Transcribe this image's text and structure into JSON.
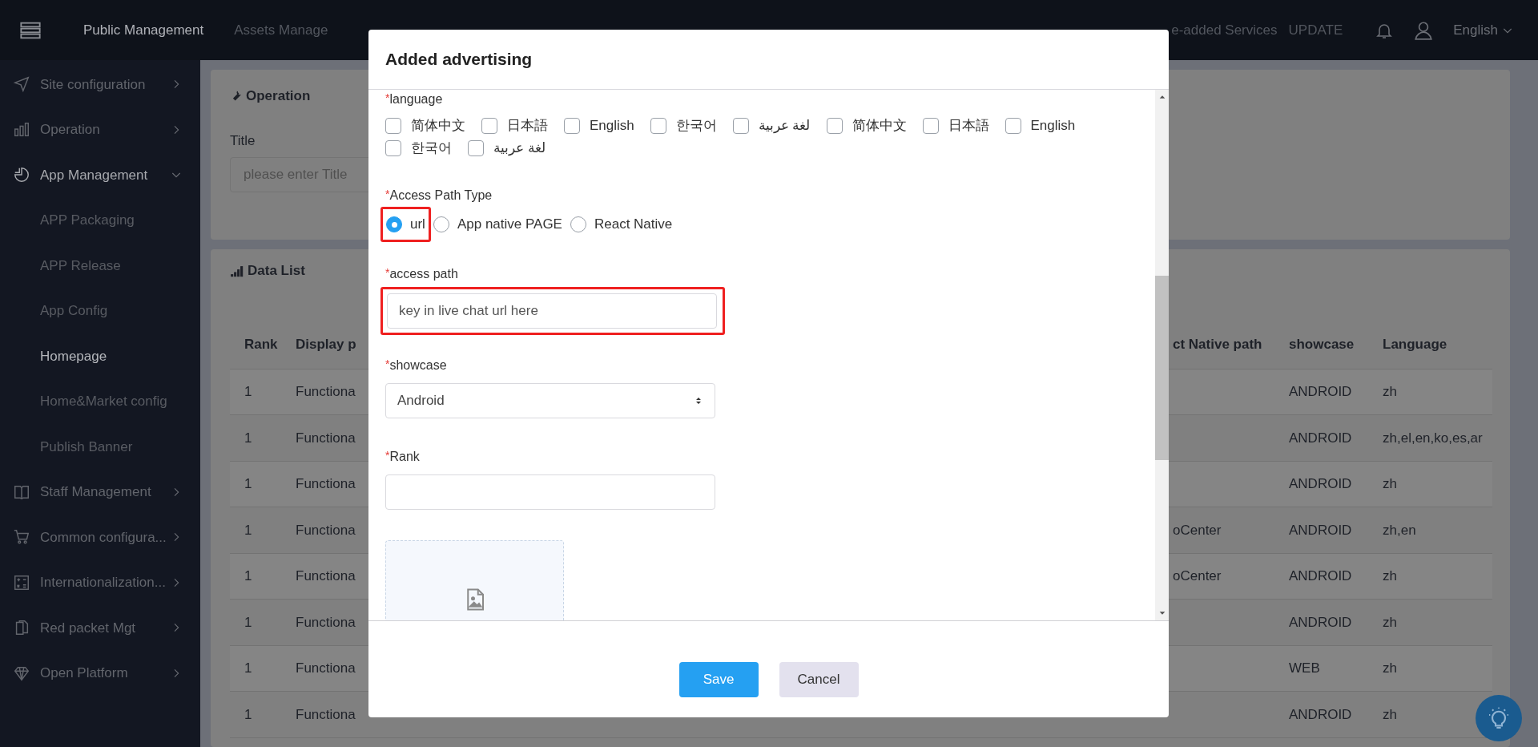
{
  "top_nav": {
    "items": [
      {
        "label": "Public Management",
        "selected": true
      },
      {
        "label": "Assets Manage",
        "selected": false
      }
    ],
    "right_items": [
      {
        "label": "e-added Services"
      },
      {
        "label": "UPDATE"
      }
    ],
    "language": "English"
  },
  "sidebar": {
    "items": [
      {
        "label": "Site configuration",
        "expanded": false
      },
      {
        "label": "Operation",
        "expanded": false
      },
      {
        "label": "App Management",
        "expanded": true,
        "children": [
          {
            "label": "APP Packaging",
            "selected": false
          },
          {
            "label": "APP Release",
            "selected": false
          },
          {
            "label": "App Config",
            "selected": false
          },
          {
            "label": "Homepage",
            "selected": true
          },
          {
            "label": "Home&Market config",
            "selected": false
          },
          {
            "label": "Publish Banner",
            "selected": false
          }
        ]
      },
      {
        "label": "Staff Management",
        "expanded": false
      },
      {
        "label": "Common configura...",
        "expanded": false
      },
      {
        "label": "Internationalization...",
        "expanded": false
      },
      {
        "label": "Red packet Mgt",
        "expanded": false
      },
      {
        "label": "Open Platform",
        "expanded": false
      }
    ]
  },
  "operation_card": {
    "title": "Operation",
    "field_label": "Title",
    "placeholder": "please enter Title"
  },
  "data_list": {
    "title": "Data List",
    "columns": [
      "Rank",
      "Display p",
      "ct Native path",
      "showcase",
      "Language"
    ],
    "rows": [
      [
        "1",
        "Functiona",
        "",
        "ANDROID",
        "zh"
      ],
      [
        "1",
        "Functiona",
        "",
        "ANDROID",
        "zh,el,en,ko,es,ar"
      ],
      [
        "1",
        "Functiona",
        "",
        "ANDROID",
        "zh"
      ],
      [
        "1",
        "Functiona",
        "oCenter",
        "ANDROID",
        "zh,en"
      ],
      [
        "1",
        "Functiona",
        "oCenter",
        "ANDROID",
        "zh"
      ],
      [
        "1",
        "Functiona",
        "",
        "ANDROID",
        "zh"
      ],
      [
        "1",
        "Functiona",
        "",
        "WEB",
        "zh"
      ],
      [
        "1",
        "Functiona",
        "",
        "ANDROID",
        "zh"
      ]
    ]
  },
  "modal": {
    "title": "Added advertising",
    "language": {
      "label": "language",
      "required_mark": "*",
      "options": [
        {
          "label": "简体中文",
          "checked": false
        },
        {
          "label": "日本語",
          "checked": false
        },
        {
          "label": "English",
          "checked": false
        },
        {
          "label": "한국어",
          "checked": false
        },
        {
          "label": "لغة عربية",
          "checked": false
        },
        {
          "label": "简体中文",
          "checked": false
        },
        {
          "label": "日本語",
          "checked": false
        },
        {
          "label": "English",
          "checked": false
        },
        {
          "label": "한국어",
          "checked": false
        },
        {
          "label": "لغة عربية",
          "checked": false
        }
      ]
    },
    "access_path_type": {
      "label": "Access Path Type",
      "required_mark": "*",
      "options": [
        {
          "label": "url",
          "selected": true,
          "highlighted": true
        },
        {
          "label": "App native PAGE",
          "selected": false,
          "highlighted": false
        },
        {
          "label": "React Native",
          "selected": false,
          "highlighted": false
        }
      ]
    },
    "access_path": {
      "label": "access path",
      "required_mark": "*",
      "placeholder": "key in live chat url here",
      "highlighted": true
    },
    "showcase": {
      "label": "showcase",
      "required_mark": "*",
      "value": "Android"
    },
    "rank": {
      "label": "Rank",
      "required_mark": "*"
    },
    "buttons": [
      {
        "label": "Save",
        "kind": "primary"
      },
      {
        "label": "Cancel",
        "kind": "secondary"
      }
    ]
  }
}
